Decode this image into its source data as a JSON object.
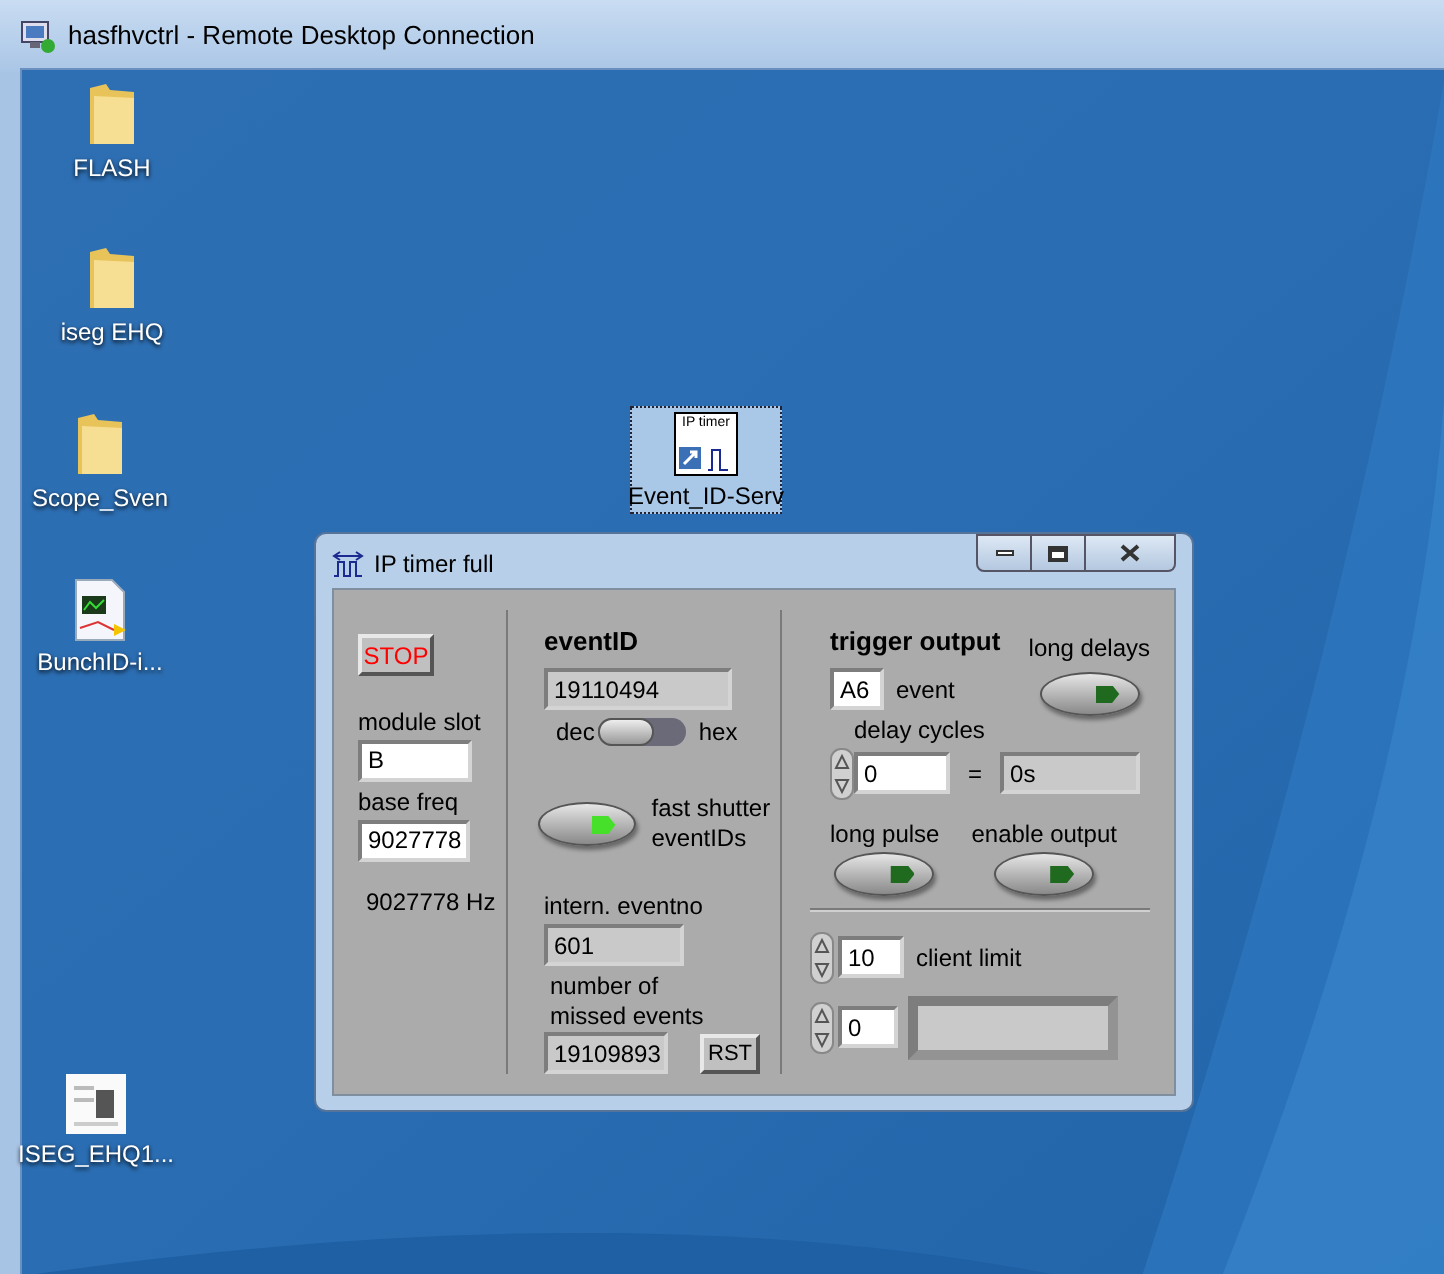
{
  "remote_window": {
    "title": "hasfhvctrl - Remote Desktop Connection"
  },
  "desktop_icons": [
    {
      "label": "FLASH",
      "kind": "folder",
      "selected": false
    },
    {
      "label": "iseg EHQ",
      "kind": "folder",
      "selected": false
    },
    {
      "label": "Scope_Sven",
      "kind": "folder",
      "selected": false
    },
    {
      "label": "BunchID-i...",
      "kind": "vi",
      "selected": false
    },
    {
      "label": "ISEG_EHQ1...",
      "kind": "document",
      "selected": false
    },
    {
      "label": "Event_ID-Serv",
      "kind": "shortcut",
      "icon_text": "IP timer",
      "selected": true
    }
  ],
  "app_window": {
    "title": "IP timer full",
    "stop_button": "STOP",
    "module_slot": {
      "label": "module slot",
      "value": "B"
    },
    "base_freq": {
      "label": "base freq",
      "value": "9027778",
      "reading": "9027778 Hz"
    },
    "event_id": {
      "heading": "eventID",
      "value": "19110494",
      "switch_left": "dec",
      "switch_right": "hex",
      "hex": false
    },
    "fast_shutter": {
      "label": "fast shutter eventIDs",
      "on": true
    },
    "intern_eventno": {
      "label": "intern. eventno",
      "value": "601"
    },
    "missed_events": {
      "label": "number of missed events",
      "value": "19109893",
      "reset_button": "RST"
    },
    "trigger_output": {
      "heading": "trigger output",
      "event_value": "A6",
      "event_label": "event",
      "long_delays": {
        "label": "long delays",
        "on": false
      },
      "delay_cycles": {
        "label": "delay cycles",
        "value": "0",
        "equals": "=",
        "result": "0s"
      },
      "long_pulse": {
        "label": "long pulse",
        "on": false
      },
      "enable_output": {
        "label": "enable output",
        "on": false
      }
    },
    "client_limit": {
      "value": "10",
      "label": "client limit"
    },
    "counter": {
      "value": "0"
    }
  }
}
